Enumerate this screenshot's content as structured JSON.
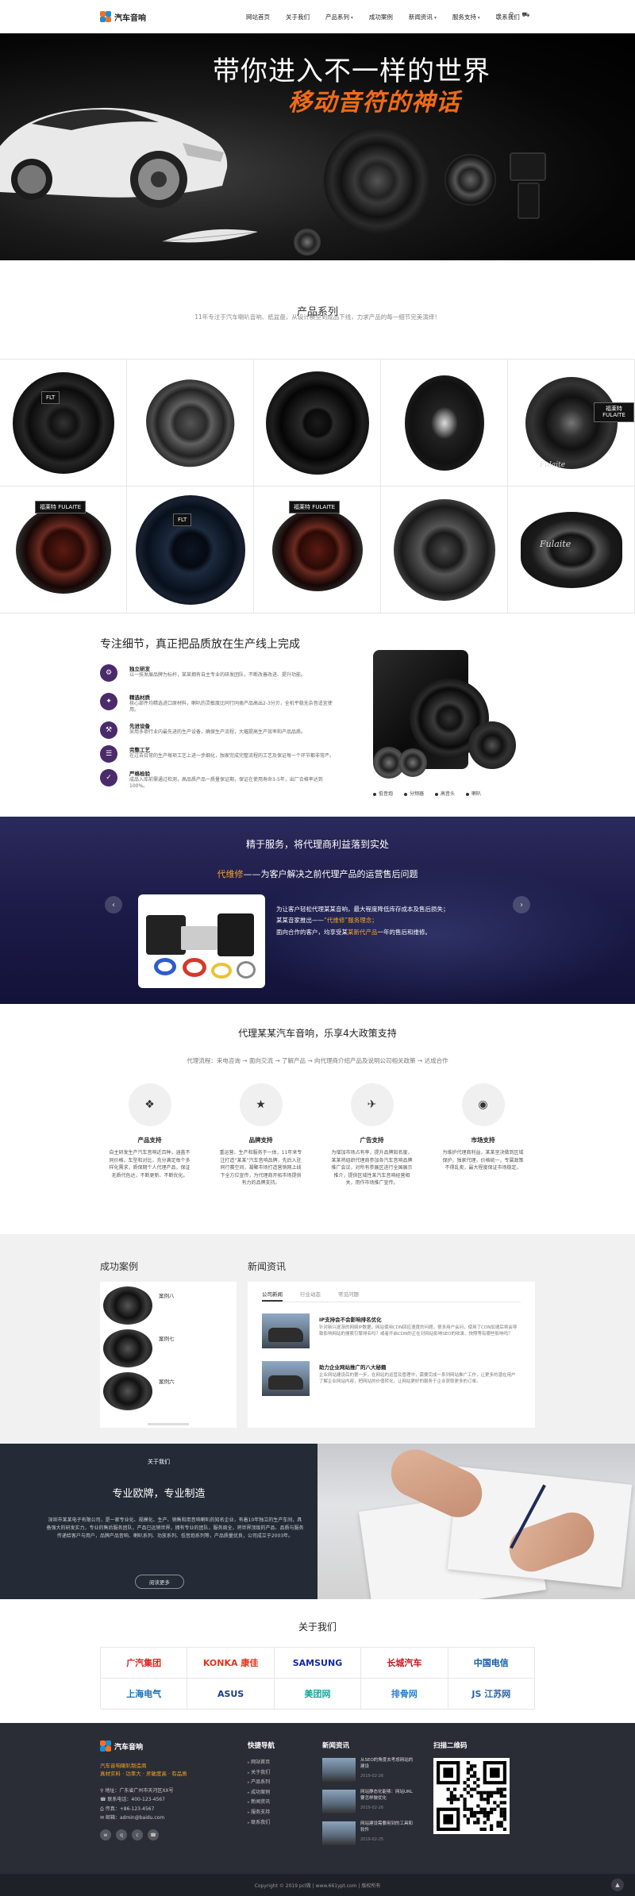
{
  "header": {
    "logo_text": "汽车音响",
    "nav": [
      {
        "label": "网站首页",
        "dropdown": false
      },
      {
        "label": "关于我们",
        "dropdown": false
      },
      {
        "label": "产品系列",
        "dropdown": true
      },
      {
        "label": "成功案例",
        "dropdown": false
      },
      {
        "label": "新闻资讯",
        "dropdown": true
      },
      {
        "label": "服务支持",
        "dropdown": true
      },
      {
        "label": "联系我们",
        "dropdown": false
      }
    ]
  },
  "banner": {
    "line1": "带你进入不一样的世界",
    "line2": "移动音符的神话"
  },
  "products": {
    "title": "产品系列",
    "subtitle": "11年专注于汽车喇叭音响、纸盆盘，从设计模型到成品下线，力求产品的每一细节完美演绎！",
    "tags": [
      "FLT",
      "福莱特 FULAITE",
      "Fulaite"
    ]
  },
  "detail": {
    "title": "专注细节，真正把品质放在生产线上完成",
    "features": [
      {
        "name": "独立研发",
        "desc": "以一技发展品牌为标杆，某某拥有自主专业的研发团队，不断改善改进、提升功能。"
      },
      {
        "name": "精选材质",
        "desc": "核心部件均精选进口原材料，喇叭的灵敏度比同行同类产品高出2-3分贝，全机平稳无杂音适宜使用。"
      },
      {
        "name": "先进设备",
        "desc": "采用多项行业内最先进的生产设备，确保生产流程，大幅提高生产效率和产品品质。"
      },
      {
        "name": "完整工艺",
        "desc": "在过去日常的生产每项工艺上进一步细化，独家完成完整流程的工艺及保证每一个环节都非常严。"
      },
      {
        "name": "严格检验",
        "desc": "成品入库前需通过检测，高品质产品一质量保证期，保证在使用寿命3-5年，出厂合格率达到100%。"
      }
    ],
    "legend": [
      "低音炮",
      "分频器",
      "高音头",
      "喇叭"
    ]
  },
  "service": {
    "title": "精于服务，将代理商利益落到实处",
    "sub_highlight": "代维修",
    "sub_rest": "——为客户解决之前代理产品的运营售后问题",
    "lines": [
      {
        "pre": "为让客户轻松代理某某音响，最大程度降低库存成本及售后损失；",
        "hl": "",
        "post": ""
      },
      {
        "pre": "某某音家推出——",
        "hl": "“代维修”服务理念；",
        "post": ""
      },
      {
        "pre": "面向合作的客户，均享受某",
        "hl": "某新代产品",
        "post": "一年的售后和维修。"
      }
    ]
  },
  "policy": {
    "title": "代理某某汽车音响，乐享4大政策支持",
    "flow": "代理流程：来电咨询  →  面向交流  →  了解产品  →  向代理商介绍产品及说明公司相关政策  →  达成合作",
    "items": [
      {
        "icon": "cubes-icon",
        "glyph": "❖",
        "name": "产品支持",
        "desc": "自主研发生产汽车音响近百种，涵盖不同价格、车型和对比，充分满足每个多样化需求，质保期个人代理产品，保证无质代色达，不断更新、不断优化。"
      },
      {
        "icon": "star-icon",
        "glyph": "★",
        "name": "品牌支持",
        "desc": "重运营、生产和服务于一体，11年来专注打造“某某”汽车音响品牌，先后入驻同行赛空间，凝聚市场打造营销网上线下全方位宣传，为代理商开拓市场提供有力的品牌支持。"
      },
      {
        "icon": "paper-plane-icon",
        "glyph": "✈",
        "name": "广告支持",
        "desc": "为增加市场占有率，提升品牌知名度，某某将组织代理商参加各汽车音响品牌推广会议，对所有参展区进行全国展示推介，提供区域性某汽车音响经营相关，用作市场推广宣传。"
      },
      {
        "icon": "globe-icon",
        "glyph": "◉",
        "name": "市场支持",
        "desc": "为维护代理商利益，某某坚决做到区域保护，独家代理，价格统一，专属政策不得乱卖，最大程度保证市场稳定。"
      }
    ]
  },
  "cases": {
    "title": "成功案例",
    "items": [
      "案例八",
      "案例七",
      "案例六"
    ]
  },
  "news": {
    "title": "新闻资讯",
    "tabs": [
      "公司新闻",
      "行业动态",
      "常见问题"
    ],
    "items": [
      {
        "title": "IP支持会不会影响排名优化",
        "desc": "针对新兴逐渐的网络IP数据，网站使用CDN回应速度的问题，很多用户会问，使用了CDN加速后将会导致影响网站的搜索引擎排名吗？或者开启CDN的正在对网站影响SEO的收录、快照等有哪些影响吗？"
      },
      {
        "title": "助力企业网站推广的八大秘籍",
        "desc": "企业网站建设后的第一步，在网站的运营及管理中，需要完成一系列网站推广工作，让更多的潜在用户了解企业网站内容，把网站的价值转化，让网站更好的服务于企业获取更多的订单。"
      }
    ]
  },
  "about": {
    "small": "关于我们",
    "title": "专业欧牌，专业制造",
    "text": "深圳市某某电子有限公司，是一家专业化、规模化、生产、销售和用音响喇叭的知名企业，有着10年独立的生产车间，具备强大的研发实力，专业的售后服务团队，产品已远销世界，拥有专业的团队，服务周全，将世界顶级的产品、品质与服务传递给客户与用户，品牌产品音响、喇叭系列、功放系列、低音炮系列等，产品质量优良，公司成立于2003年。",
    "button": "阅读更多"
  },
  "partners": {
    "title": "关于我们",
    "logos": [
      {
        "text": "广汽集团",
        "color": "#d7241c"
      },
      {
        "text": "KONKA 康佳",
        "color": "#e4331c"
      },
      {
        "text": "SAMSUNG",
        "color": "#1428a0"
      },
      {
        "text": "长城汽车",
        "color": "#c8161d"
      },
      {
        "text": "中国电信",
        "color": "#0d5aa7"
      },
      {
        "text": "上海电气",
        "color": "#1a6fb5"
      },
      {
        "text": "ASUS",
        "color": "#1b3a8c"
      },
      {
        "text": "美团网",
        "color": "#1aa39a"
      },
      {
        "text": "排骨网",
        "color": "#2a7fd4"
      },
      {
        "text": "JS 江苏网",
        "color": "#2a62a8"
      }
    ]
  },
  "footer": {
    "logo_text": "汽车音响",
    "slogan1": "汽车音响喇叭制造商",
    "slogan2": "真材实料 · 功率大 · 灵敏度高 · 有品质",
    "info": [
      "地址：广东省广州市天河区XX号",
      "联系电话：400-123-4567",
      "传真：+86-123-4567",
      "邮箱：admin@baidu.com"
    ],
    "nav_title": "快捷导航",
    "links": [
      "网站首页",
      "关于我们",
      "产品系列",
      "成功案例",
      "新闻资讯",
      "服务支持",
      "联系我们"
    ],
    "news_title": "新闻资讯",
    "news": [
      {
        "title": "从SEO的角度去考虑网站的建设",
        "date": "2019-02-26"
      },
      {
        "title": "网站静态化能够：网站URL要怎样做优化",
        "date": "2019-02-26"
      },
      {
        "title": "网站建设需要用到的工具和软件",
        "date": "2019-02-25"
      }
    ],
    "qr_title": "扫描二维码",
    "copyright": "Copyright © 2019 pcl做 | www.661ypt.com | 版权所有"
  }
}
